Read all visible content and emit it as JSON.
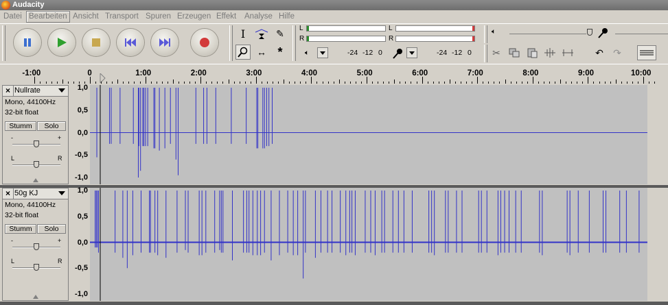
{
  "window": {
    "title": "Audacity"
  },
  "menu": [
    "Datei",
    "Bearbeiten",
    "Ansicht",
    "Transport",
    "Spuren",
    "Erzeugen",
    "Effekt",
    "Analyse",
    "Hilfe"
  ],
  "meters": {
    "left": "L",
    "right": "R",
    "db1": "-24",
    "db2": "-12",
    "db3": "0"
  },
  "ruler": {
    "ticks": [
      "-1:00",
      "0",
      "1:00",
      "2:00",
      "3:00",
      "4:00",
      "5:00",
      "6:00",
      "7:00",
      "8:00",
      "9:00",
      "10:00"
    ]
  },
  "vruler": [
    "1,0",
    "0,5",
    "0,0",
    "-0,5",
    "-1,0"
  ],
  "tracks": [
    {
      "name": "Nullrate",
      "info1": "Mono, 44100Hz",
      "info2": "32-bit float",
      "mute": "Stumm",
      "solo": "Solo",
      "gain_minus": "-",
      "gain_plus": "+",
      "pan_left": "L",
      "pan_right": "R",
      "spikes": [
        [
          0.05,
          1,
          -0.55
        ],
        [
          0.28,
          1,
          -0.25
        ],
        [
          0.31,
          1,
          -0.25
        ],
        [
          0.47,
          1,
          -0.25
        ],
        [
          0.71,
          1,
          -0.25
        ],
        [
          0.8,
          1,
          -1
        ],
        [
          0.81,
          1,
          -0.3
        ],
        [
          0.84,
          1,
          -0.85
        ],
        [
          0.88,
          1,
          -0.3
        ],
        [
          0.9,
          1,
          -0.3
        ],
        [
          0.93,
          1,
          -0.3
        ],
        [
          0.97,
          1,
          -0.3
        ],
        [
          1.08,
          1,
          -0.35
        ],
        [
          1.1,
          1,
          -0.35
        ],
        [
          1.18,
          1,
          -0.4
        ],
        [
          1.28,
          1,
          -0.35
        ],
        [
          1.38,
          1,
          -0.25
        ],
        [
          1.48,
          1,
          -0.6
        ],
        [
          1.52,
          1,
          -0.95
        ],
        [
          1.84,
          1,
          -0.25
        ],
        [
          1.98,
          1,
          -0.25
        ],
        [
          2.04,
          1,
          -0.25
        ],
        [
          2.2,
          1,
          -0.25
        ],
        [
          2.48,
          1,
          -0.25
        ],
        [
          2.75,
          1,
          -0.25
        ],
        [
          2.94,
          1,
          -0.35
        ],
        [
          2.96,
          1,
          -0.35
        ],
        [
          3.05,
          1,
          -0.35
        ],
        [
          3.08,
          1,
          -0.35
        ],
        [
          3.12,
          1,
          -0.3
        ],
        [
          3.16,
          1,
          -0.3
        ],
        [
          3.22,
          1,
          -0.25
        ]
      ]
    },
    {
      "name": "50g KJ",
      "info1": "Mono, 44100Hz",
      "info2": "32-bit float",
      "mute": "Stumm",
      "solo": "Solo",
      "gain_minus": "-",
      "gain_plus": "+",
      "pan_left": "L",
      "pan_right": "R",
      "spikes": [
        [
          0.02,
          1,
          -0.1
        ],
        [
          0.04,
          1,
          -0.1
        ],
        [
          0.06,
          1,
          -0.1
        ],
        [
          0.08,
          1,
          -0.2
        ],
        [
          0.38,
          1,
          -0.2
        ],
        [
          0.52,
          1,
          -0.3
        ],
        [
          0.6,
          1,
          -0.5
        ],
        [
          0.7,
          1,
          -0.25
        ],
        [
          0.85,
          1,
          -0.2
        ],
        [
          1.0,
          1,
          -0.2
        ],
        [
          1.02,
          1,
          -0.2
        ],
        [
          1.1,
          1,
          -0.2
        ],
        [
          1.15,
          1,
          -0.25
        ],
        [
          1.3,
          1,
          -0.3
        ],
        [
          1.5,
          1,
          -0.2
        ],
        [
          1.65,
          1,
          -0.15
        ],
        [
          1.7,
          1,
          -0.2
        ],
        [
          1.9,
          1,
          -0.25
        ],
        [
          1.95,
          1,
          -0.25
        ],
        [
          2.02,
          1,
          -0.2
        ],
        [
          2.18,
          1,
          -0.2
        ],
        [
          2.27,
          1,
          -0.15
        ],
        [
          2.3,
          1,
          -0.2
        ],
        [
          2.33,
          1,
          -0.2
        ],
        [
          2.5,
          1,
          -0.35
        ],
        [
          2.7,
          1,
          -0.2
        ],
        [
          2.76,
          1,
          -0.2
        ],
        [
          2.8,
          1,
          -0.2
        ],
        [
          2.87,
          1,
          -0.25
        ],
        [
          2.95,
          1,
          -0.25
        ],
        [
          3.01,
          1,
          -0.25
        ],
        [
          3.08,
          1,
          -0.2
        ],
        [
          3.2,
          1,
          -0.35
        ],
        [
          3.35,
          1,
          -0.25
        ],
        [
          3.5,
          1,
          -0.2
        ],
        [
          3.6,
          1,
          -0.25
        ],
        [
          3.68,
          1,
          -0.25
        ],
        [
          3.78,
          1,
          -0.7
        ],
        [
          3.82,
          1,
          -0.2
        ],
        [
          4.0,
          1,
          -0.3
        ],
        [
          4.1,
          1,
          -0.2
        ],
        [
          4.22,
          1,
          -0.2
        ],
        [
          4.3,
          1,
          -0.2
        ],
        [
          4.45,
          1,
          -0.2
        ],
        [
          4.55,
          1,
          -0.25
        ],
        [
          4.62,
          1,
          -0.2
        ],
        [
          4.66,
          1,
          -0.2
        ],
        [
          4.72,
          1,
          -0.25
        ],
        [
          4.9,
          1,
          -0.2
        ],
        [
          5.0,
          1,
          -0.2
        ],
        [
          5.08,
          1,
          -0.25
        ],
        [
          5.2,
          1,
          -0.2
        ],
        [
          5.25,
          1,
          -0.2
        ],
        [
          5.4,
          1,
          -0.2
        ],
        [
          5.5,
          1,
          -0.2
        ],
        [
          5.6,
          1,
          -0.2
        ],
        [
          5.75,
          1,
          -0.2
        ],
        [
          6.05,
          1,
          -0.2
        ],
        [
          6.1,
          1,
          -0.2
        ],
        [
          6.15,
          1,
          -0.25
        ],
        [
          6.35,
          1,
          -0.2
        ],
        [
          6.4,
          1,
          -0.2
        ],
        [
          6.55,
          1,
          -0.2
        ],
        [
          6.65,
          1,
          -0.2
        ],
        [
          6.95,
          1,
          -0.2
        ],
        [
          7.0,
          1,
          -0.2
        ],
        [
          7.1,
          1,
          -0.2
        ],
        [
          7.3,
          1,
          -0.25
        ],
        [
          7.35,
          1,
          -0.2
        ],
        [
          7.42,
          1,
          -0.2
        ],
        [
          7.5,
          1,
          -0.2
        ],
        [
          7.62,
          1,
          -0.2
        ],
        [
          7.72,
          1,
          -0.2
        ],
        [
          8.05,
          1,
          -0.2
        ],
        [
          8.1,
          1,
          -0.25
        ],
        [
          8.55,
          1,
          -0.2
        ],
        [
          8.6,
          1,
          -0.25
        ],
        [
          8.75,
          1,
          -0.2
        ],
        [
          8.95,
          1,
          -0.2
        ],
        [
          9.2,
          1,
          -0.2
        ],
        [
          9.25,
          1,
          -0.2
        ],
        [
          9.5,
          1,
          -0.2
        ],
        [
          9.62,
          1,
          -0.2
        ],
        [
          9.85,
          1,
          -0.2
        ]
      ]
    }
  ],
  "colors": {
    "wave": "#3232c8",
    "wave_bg": "#c0c0c0",
    "ui_bg": "#d4d0c8"
  }
}
